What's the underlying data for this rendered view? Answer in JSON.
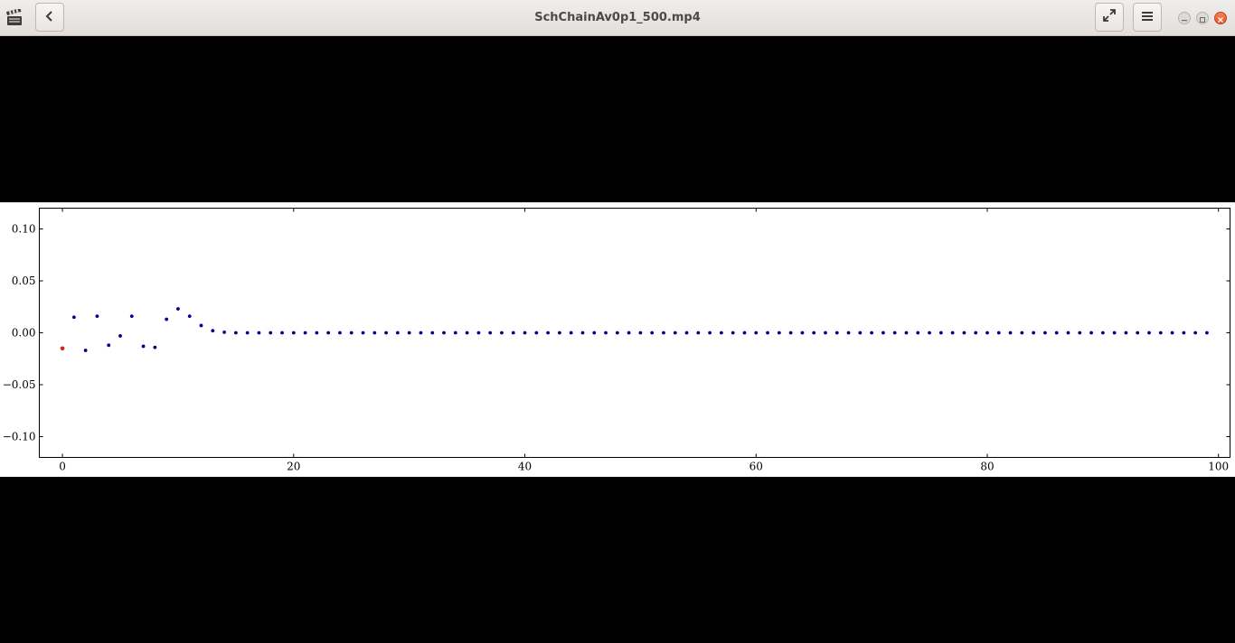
{
  "window": {
    "title": "SchChainAv0p1_500.mp4",
    "icons": {
      "app": "clapperboard-icon",
      "back": "chevron-left-icon",
      "fullscreen": "fullscreen-expand-icon",
      "menu": "hamburger-menu-icon",
      "minimize": "minimize-icon",
      "maximize": "maximize-icon",
      "close": "close-icon"
    },
    "colors": {
      "close": "#e95420"
    }
  },
  "chart_data": {
    "type": "scatter",
    "xlim": [
      -2,
      101
    ],
    "ylim": [
      -0.12,
      0.12
    ],
    "xticks": [
      0,
      20,
      40,
      60,
      80,
      100
    ],
    "yticks": [
      -0.1,
      -0.05,
      0.0,
      0.05,
      0.1
    ],
    "xtick_labels": [
      "0",
      "20",
      "40",
      "60",
      "80",
      "100"
    ],
    "ytick_labels": [
      "−0.10",
      "−0.05",
      "0.00",
      "0.05",
      "0.10"
    ],
    "grid": false,
    "series": [
      {
        "color": "#d62018",
        "x": [
          0
        ],
        "y": [
          -0.015
        ]
      },
      {
        "color": "#00008b",
        "x": [
          1,
          2,
          3,
          4,
          5,
          6,
          7,
          8,
          9,
          10,
          11,
          12,
          13,
          14,
          15,
          16,
          17,
          18,
          19,
          20,
          21,
          22,
          23,
          24,
          25,
          26,
          27,
          28,
          29,
          30,
          31,
          32,
          33,
          34,
          35,
          36,
          37,
          38,
          39,
          40,
          41,
          42,
          43,
          44,
          45,
          46,
          47,
          48,
          49,
          50,
          51,
          52,
          53,
          54,
          55,
          56,
          57,
          58,
          59,
          60,
          61,
          62,
          63,
          64,
          65,
          66,
          67,
          68,
          69,
          70,
          71,
          72,
          73,
          74,
          75,
          76,
          77,
          78,
          79,
          80,
          81,
          82,
          83,
          84,
          85,
          86,
          87,
          88,
          89,
          90,
          91,
          92,
          93,
          94,
          95,
          96,
          97,
          98,
          99
        ],
        "y": [
          0.015,
          -0.017,
          0.016,
          -0.012,
          -0.003,
          0.016,
          -0.013,
          -0.014,
          0.013,
          0.023,
          0.016,
          0.007,
          0.002,
          0.0005,
          0,
          0,
          0,
          0,
          0,
          0,
          0,
          0,
          0,
          0,
          0,
          0,
          0,
          0,
          0,
          0,
          0,
          0,
          0,
          0,
          0,
          0,
          0,
          0,
          0,
          0,
          0,
          0,
          0,
          0,
          0,
          0,
          0,
          0,
          0,
          0,
          0,
          0,
          0,
          0,
          0,
          0,
          0,
          0,
          0,
          0,
          0,
          0,
          0,
          0,
          0,
          0,
          0,
          0,
          0,
          0,
          0,
          0,
          0,
          0,
          0,
          0,
          0,
          0,
          0,
          0,
          0,
          0,
          0,
          0,
          0,
          0,
          0,
          0,
          0,
          0,
          0,
          0,
          0,
          0,
          0,
          0,
          0,
          0,
          0
        ]
      }
    ]
  }
}
